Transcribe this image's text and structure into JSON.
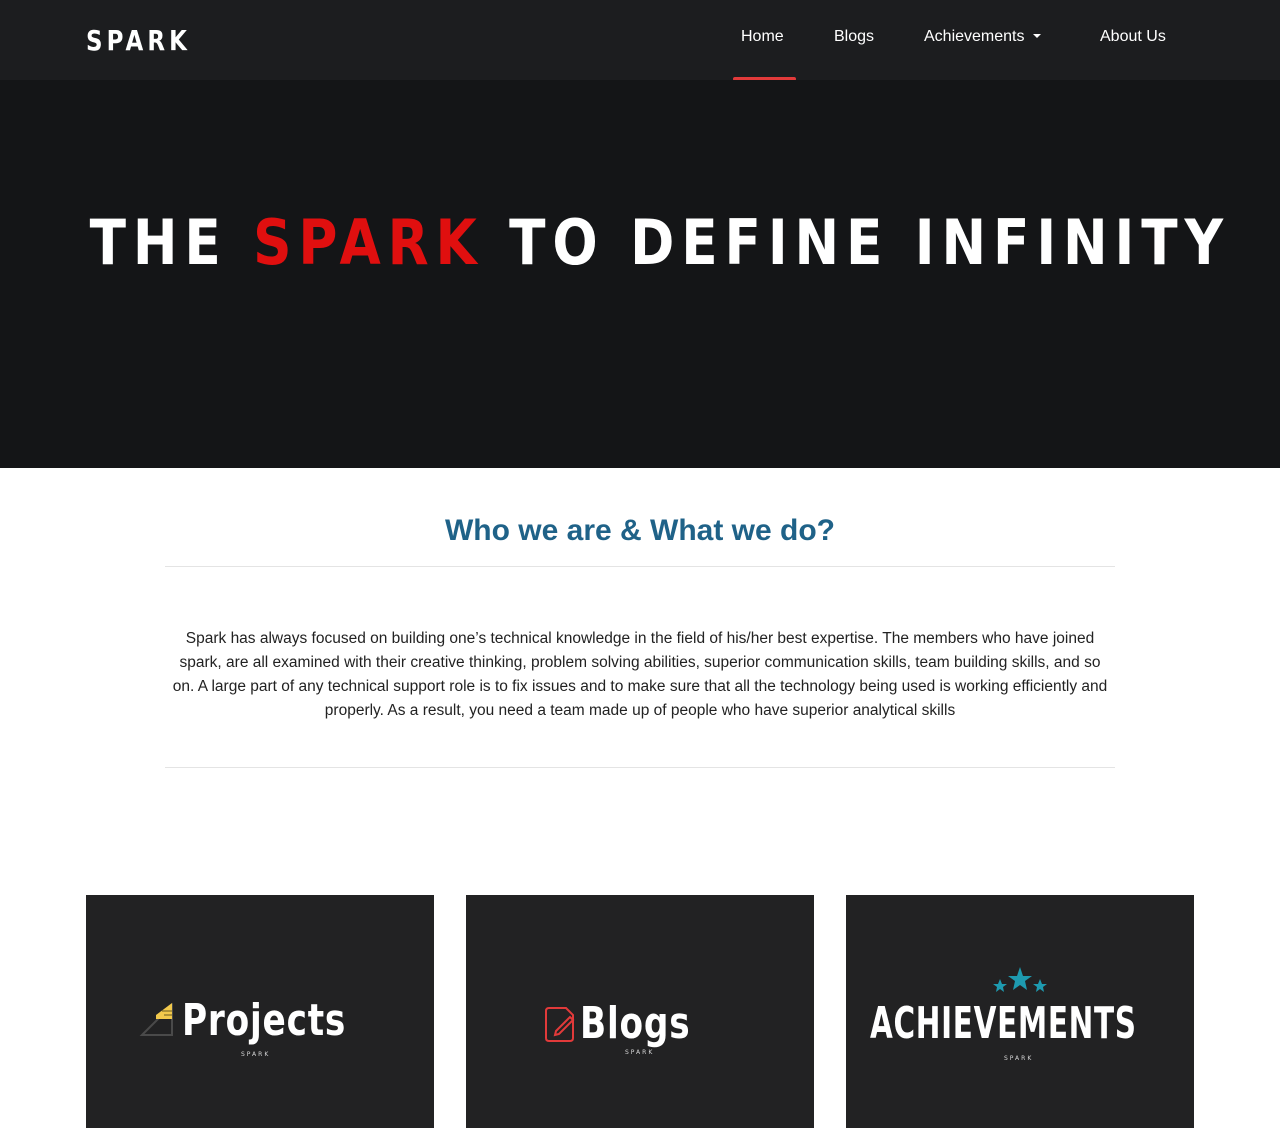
{
  "navbar": {
    "brand": "SPARK",
    "items": [
      {
        "label": "Home",
        "active": true
      },
      {
        "label": "Blogs"
      },
      {
        "label": "Achievements",
        "dropdown": true
      },
      {
        "label": "About Us"
      }
    ]
  },
  "hero": {
    "title_prefix": "THE ",
    "title_accent": "SPARK",
    "title_suffix": " TO DEFINE INFINITY",
    "accent_color": "#e00f0f"
  },
  "about": {
    "heading": "Who we are & What we do?",
    "body": "Spark has always focused on building one’s technical knowledge in the field of his/her best expertise. The members who have joined spark, are all examined with their creative thinking, problem solving abilities, superior communication skills, team building skills, and so on. A large part of any technical support role is to fix issues and to make sure that all the technology being used is working efficiently and properly. As a result, you need a team made up of people who have superior analytical skills"
  },
  "cards": [
    {
      "title": "Projects",
      "subtitle": "SPARK",
      "icon": "ruler-triangle-icon"
    },
    {
      "title": "Blogs",
      "subtitle": "SPARK",
      "icon": "notebook-pen-icon"
    },
    {
      "title": "ACHIEVEMENTS",
      "subtitle": "SPARK",
      "icon": "three-stars-icon"
    }
  ],
  "colors": {
    "navbar_bg": "#1c1d1f",
    "hero_bg": "#141517",
    "active_underline": "#e23a3a",
    "heading": "#1f6288",
    "card_bg": "#222223",
    "stars": "#1e9bb0"
  }
}
